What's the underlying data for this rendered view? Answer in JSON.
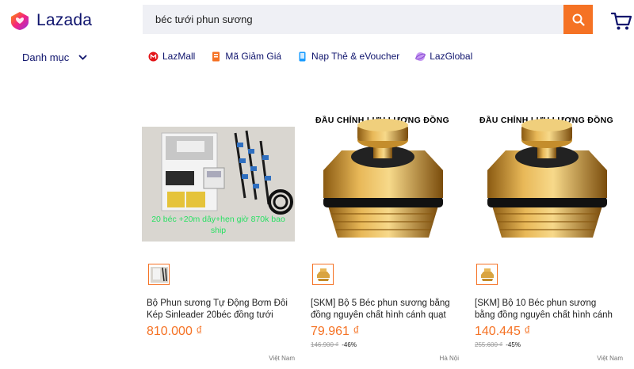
{
  "header": {
    "logo_text": "Lazada",
    "search_value": "béc tưới phun sương"
  },
  "nav": {
    "category_label": "Danh mục",
    "links": [
      {
        "label": "LazMall",
        "icon": "lazmall-icon",
        "color": "#e3161a"
      },
      {
        "label": "Mã Giảm Giá",
        "icon": "voucher-icon",
        "color": "#f57224"
      },
      {
        "label": "Nạp Thẻ & eVoucher",
        "icon": "topup-icon",
        "color": "#1a9cff"
      },
      {
        "label": "LazGlobal",
        "icon": "lazglobal-icon",
        "color": "#8e4fd6"
      }
    ]
  },
  "products": [
    {
      "image_text": "20 béc +20m dây+hẹn giờ 870k bao ship",
      "title": "Bộ Phun sương Tự Động Bơm Đôi Kép Sinleader 20béc đồng tưới cây,...",
      "price": "810.000 ₫",
      "original_price": "",
      "discount": "",
      "location": "Việt Nam"
    },
    {
      "banner": "ĐẦU CHỈNH LƯU LƯỢNG ĐỒNG",
      "title": "[SKM] Bộ 5 Béc phun sương bằng đồng nguyên chất hình cánh quạt (...",
      "price": "79.961 ₫",
      "original_price": "146.900 ₫",
      "discount": "-46%",
      "location": "Hà Nội"
    },
    {
      "banner": "ĐẦU CHỈNH LƯU LƯỢNG ĐỒNG",
      "title": "[SKM] Bộ 10 Béc phun sương bằng đồng nguyên chất hình cánh quạt (...",
      "price": "140.445 ₫",
      "original_price": "255.600 ₫",
      "discount": "-45%",
      "location": "Việt Nam"
    }
  ],
  "colors": {
    "accent": "#f57224",
    "brand": "#0f146d",
    "search_bg": "#eff0f5"
  }
}
